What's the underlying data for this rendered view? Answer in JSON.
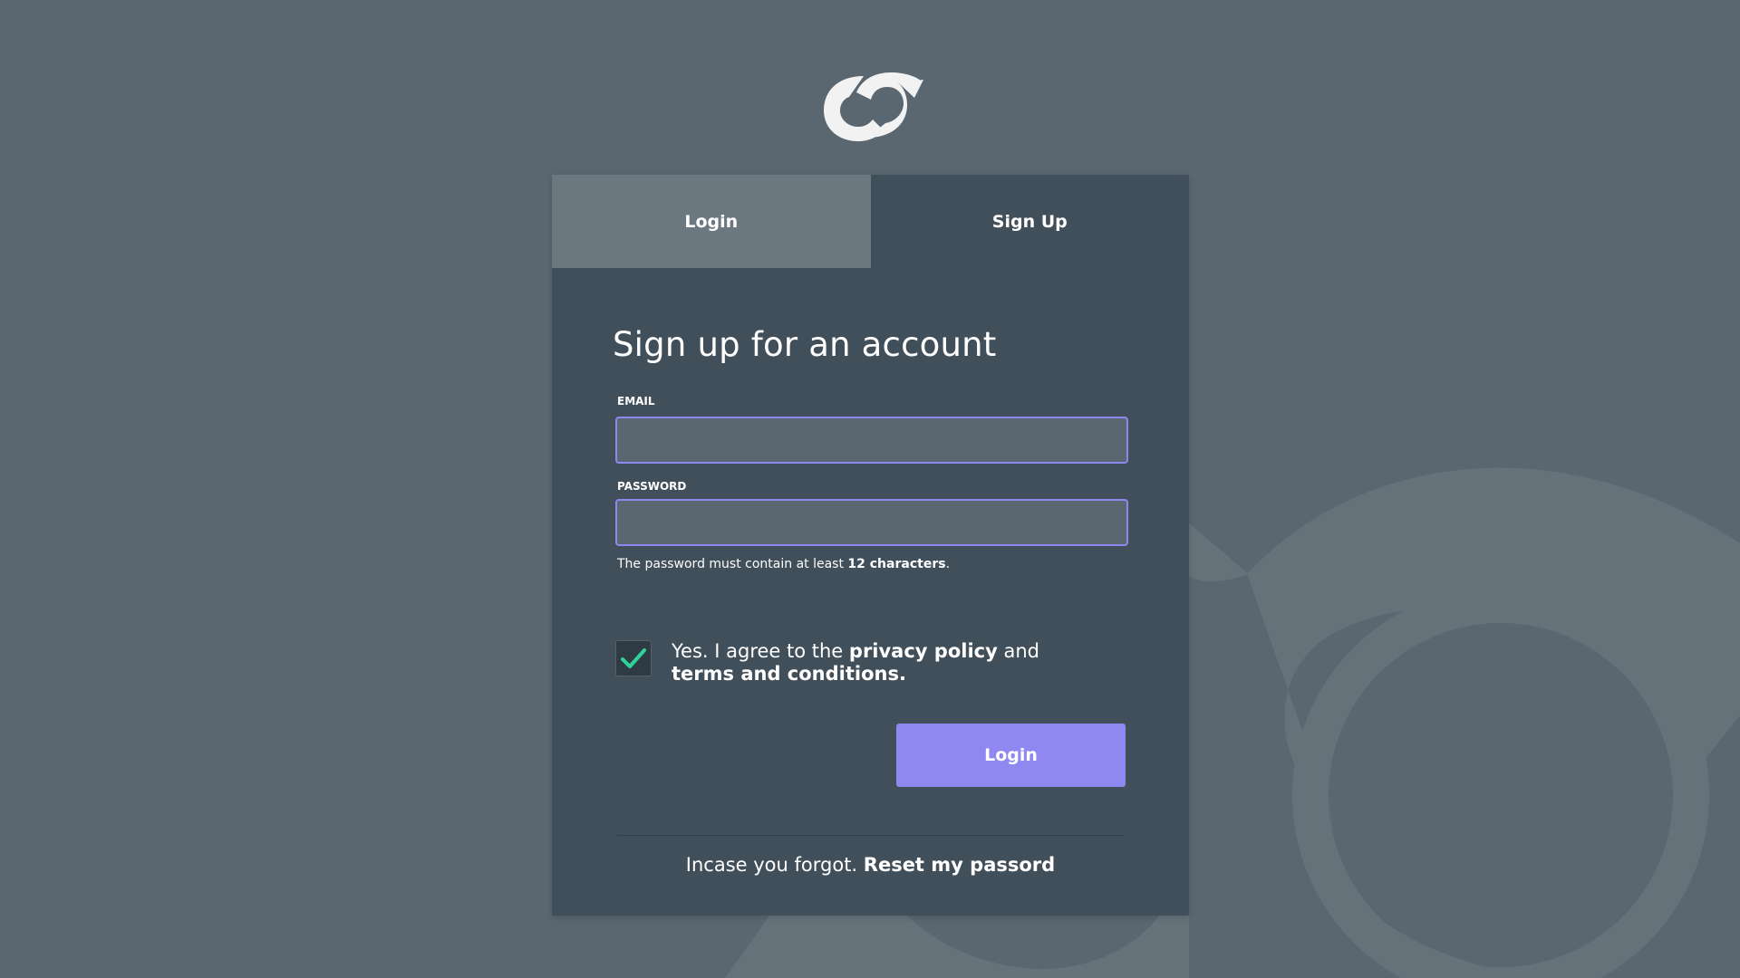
{
  "tabs": [
    {
      "label": "Login",
      "active": false
    },
    {
      "label": "Sign Up",
      "active": true
    }
  ],
  "form": {
    "heading": "Sign up for an account",
    "email_label": "EMAIL",
    "email_value": "",
    "password_label": "PASSWORD",
    "password_value": "",
    "password_hint_prefix": "The password must contain at least ",
    "password_hint_bold": "12 characters",
    "password_hint_suffix": ".",
    "agree_checked": true,
    "agree_prefix": "Yes. I agree to the ",
    "agree_privacy": "privacy policy",
    "agree_and": " and ",
    "agree_terms": "terms and conditions.",
    "submit_label": "Login",
    "forgot_prefix": "Incase you forgot. ",
    "forgot_link": "Reset my passord"
  },
  "colors": {
    "background": "#5a6670",
    "card": "#414f5a",
    "inactive_tab": "#6b7880",
    "accent": "#8e88f0",
    "check": "#2fd39a"
  },
  "icons": {
    "logo": "brand-logo",
    "checkbox": "checkmark-icon"
  }
}
